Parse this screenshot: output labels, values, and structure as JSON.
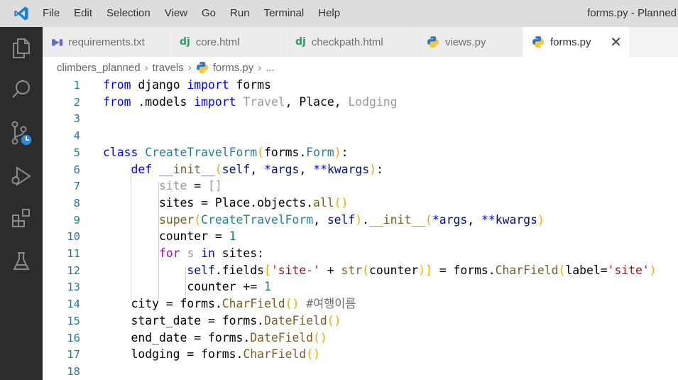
{
  "menu": [
    "File",
    "Edit",
    "Selection",
    "View",
    "Go",
    "Run",
    "Terminal",
    "Help"
  ],
  "window_title": "forms.py - Planned",
  "tabs": [
    {
      "label": "requirements.txt",
      "icon": "requirements-icon",
      "active": false
    },
    {
      "label": "core.html",
      "icon": "django-icon",
      "active": false
    },
    {
      "label": "checkpath.html",
      "icon": "django-icon",
      "active": false
    },
    {
      "label": "views.py",
      "icon": "python-icon",
      "active": false
    },
    {
      "label": "forms.py",
      "icon": "python-icon",
      "active": true
    }
  ],
  "breadcrumb": [
    "climbers_planned",
    "travels",
    "forms.py",
    "..."
  ],
  "activity_bar": [
    "explorer-icon",
    "search-icon",
    "source-control-icon",
    "run-debug-icon",
    "extensions-icon",
    "testing-icon"
  ],
  "code": [
    "from django import forms",
    "from .models import Travel, Place, Lodging",
    "",
    "",
    "class CreateTravelForm(forms.Form):",
    "    def __init__(self, *args, **kwargs):",
    "        site = []",
    "        sites = Place.objects.all()",
    "        super(CreateTravelForm, self).__init__(*args, **kwargs)",
    "        counter = 1",
    "        for s in sites:",
    "            self.fields['site-' + str(counter)] = forms.CharField(label='site')",
    "            counter += 1",
    "    city = forms.CharField() #여행이름",
    "    start_date = forms.DateField()",
    "    end_date = forms.DateField()",
    "    lodging = forms.CharField()",
    ""
  ],
  "line_numbers": [
    "1",
    "2",
    "3",
    "4",
    "5",
    "6",
    "7",
    "8",
    "9",
    "10",
    "11",
    "12",
    "13",
    "14",
    "15",
    "16",
    "17",
    "18"
  ],
  "colors": {
    "keyword": "#0000ff",
    "control": "#af00db",
    "class": "#267f99",
    "function": "#795e26",
    "number": "#098658",
    "string": "#a31515",
    "bracket": "#e5b000",
    "line_number": "#237893"
  }
}
